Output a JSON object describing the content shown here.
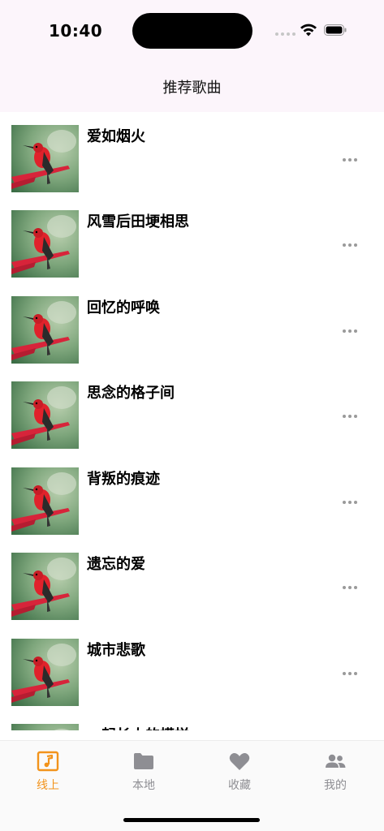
{
  "status_bar": {
    "time": "10:40"
  },
  "nav": {
    "title": "推荐歌曲"
  },
  "songs": [
    {
      "title": "爱如烟火"
    },
    {
      "title": "风雪后田埂相思"
    },
    {
      "title": "回忆的呼唤"
    },
    {
      "title": "思念的格子间"
    },
    {
      "title": "背叛的痕迹"
    },
    {
      "title": "遗忘的爱"
    },
    {
      "title": "城市悲歌"
    },
    {
      "title": "一起长大的模样"
    }
  ],
  "tabbar": {
    "tabs": [
      {
        "label": "线上",
        "icon": "music-note-icon",
        "active": true
      },
      {
        "label": "本地",
        "icon": "folder-icon",
        "active": false
      },
      {
        "label": "收藏",
        "icon": "heart-icon",
        "active": false
      },
      {
        "label": "我的",
        "icon": "users-icon",
        "active": false
      }
    ]
  },
  "colors": {
    "accent": "#f2931b",
    "inactive": "#8e8e93",
    "header_bg": "#fcf5fb"
  }
}
